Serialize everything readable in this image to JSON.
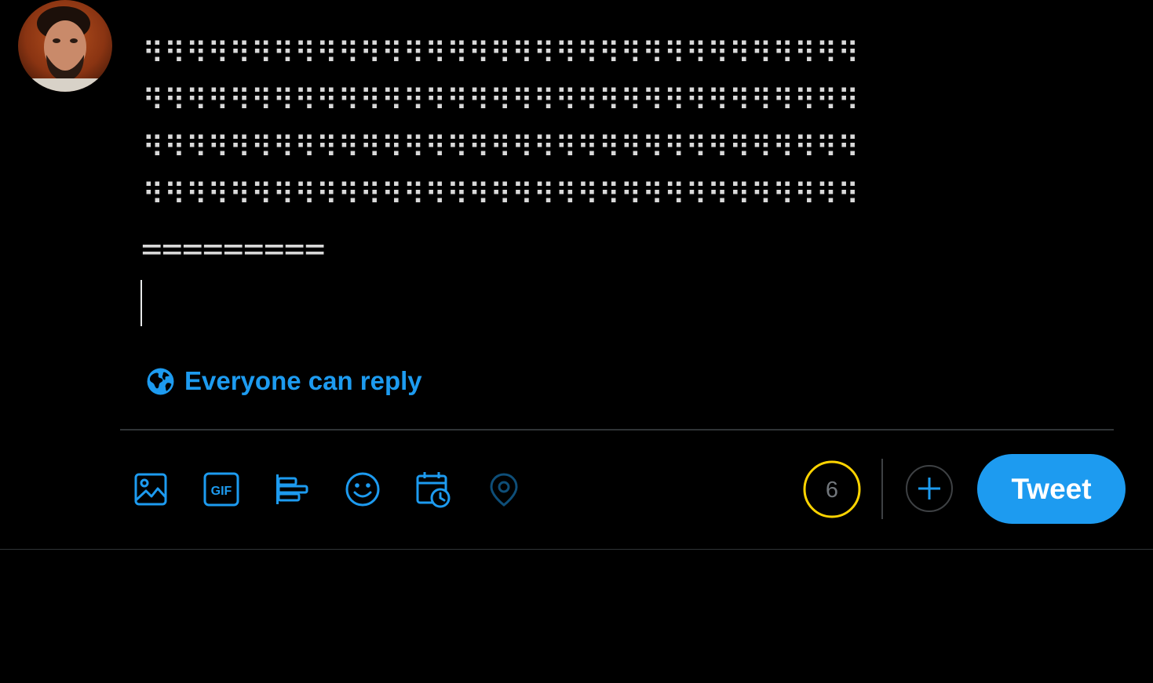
{
  "composer": {
    "tweet_text": {
      "braille_lines": [
        "⠻⠻⠻⠻⠻⠻⠻⠻⠻⠻⠻⠻⠻⠻⠻⠻⠻⠻⠻⠻⠻⠻⠻⠻⠻⠻⠻⠻⠻⠻⠻⠻⠻",
        "⠻⠻⠻⠻⠻⠻⠻⠻⠻⠻⠻⠻⠻⠻⠻⠻⠻⠻⠻⠻⠻⠻⠻⠻⠻⠻⠻⠻⠻⠻⠻⠻⠻",
        "⠻⠻⠻⠻⠻⠻⠻⠻⠻⠻⠻⠻⠻⠻⠻⠻⠻⠻⠻⠻⠻⠻⠻⠻⠻⠻⠻⠻⠻⠻⠻⠻⠻",
        "⠻⠻⠻⠻⠻⠻⠻⠻⠻⠻⠻⠻⠻⠻⠻⠻⠻⠻⠻⠻⠻⠻⠻⠻⠻⠻⠻⠻⠻⠻⠻⠻⠻"
      ],
      "separator": "========="
    },
    "reply_setting": {
      "label": "Everyone can reply",
      "icon": "globe-icon"
    },
    "toolbar": {
      "tools": [
        {
          "name": "media",
          "icon": "image-icon"
        },
        {
          "name": "gif",
          "icon": "gif-icon",
          "label": "GIF"
        },
        {
          "name": "poll",
          "icon": "poll-icon"
        },
        {
          "name": "emoji",
          "icon": "emoji-icon"
        },
        {
          "name": "schedule",
          "icon": "schedule-icon"
        },
        {
          "name": "location",
          "icon": "location-icon",
          "disabled": true
        }
      ]
    },
    "char_counter": {
      "remaining": "6",
      "ring_color": "#ffd400"
    },
    "add_thread": {
      "icon": "plus-icon"
    },
    "tweet_button": {
      "label": "Tweet"
    }
  },
  "colors": {
    "accent": "#1d9bf0",
    "background": "#000000",
    "border": "#2f3336",
    "text": "#d9d9d9",
    "warning": "#ffd400"
  }
}
